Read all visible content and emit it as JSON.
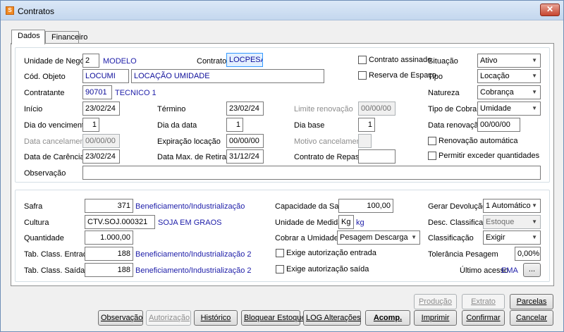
{
  "window": {
    "title": "Contratos"
  },
  "tabs": [
    {
      "label": "Dados"
    },
    {
      "label": "Financeiro"
    }
  ],
  "dados": {
    "unidade_negocio": {
      "label": "Unidade de Negócio",
      "value": "2",
      "desc": "MODELO"
    },
    "contrato": {
      "label": "Contrato",
      "value": "LOCPESAG"
    },
    "contrato_assinado": {
      "label": "Contrato assinado"
    },
    "situacao": {
      "label": "Situação",
      "value": "Ativo"
    },
    "cod_objeto": {
      "label": "Cód. Objeto",
      "value": "LOCUMI",
      "desc": "LOCAÇÃO UMIDADE"
    },
    "reserva_espaco": {
      "label": "Reserva de Espaço"
    },
    "tipo": {
      "label": "Tipo",
      "value": "Locação"
    },
    "contratante": {
      "label": "Contratante",
      "value": "90701",
      "desc": "TECNICO 1"
    },
    "natureza": {
      "label": "Natureza",
      "value": "Cobrança"
    },
    "inicio": {
      "label": "Início",
      "value": "23/02/24"
    },
    "termino": {
      "label": "Término",
      "value": "23/02/24"
    },
    "limite_renovacao": {
      "label": "Limite renovação",
      "value": "00/00/00"
    },
    "tipo_cobranca": {
      "label": "Tipo de Cobrança",
      "value": "Umidade"
    },
    "dia_vencimento": {
      "label": "Dia do vencimento",
      "value": "1"
    },
    "dia_data": {
      "label": "Dia da data",
      "value": "1"
    },
    "dia_base": {
      "label": "Dia base",
      "value": "1"
    },
    "data_renovacao": {
      "label": "Data renovação",
      "value": "00/00/00"
    },
    "data_cancelamento": {
      "label": "Data cancelamento",
      "value": "00/00/00"
    },
    "expiracao_locacao": {
      "label": "Expiração locação",
      "value": "00/00/00"
    },
    "motivo_cancelamento": {
      "label": "Motivo cancelamento",
      "value": ""
    },
    "renovacao_automatica": {
      "label": "Renovação automática"
    },
    "data_carencia": {
      "label": "Data de Carência",
      "value": "23/02/24"
    },
    "data_max_retirada": {
      "label": "Data Max. de Retirada",
      "value": "31/12/24"
    },
    "contrato_repasse": {
      "label": "Contrato de Repasse",
      "value": ""
    },
    "permitir_exceder": {
      "label": "Permitir exceder quantidades"
    },
    "observacao": {
      "label": "Observação",
      "value": ""
    }
  },
  "produto": {
    "safra": {
      "label": "Safra",
      "value": "371",
      "desc": "Beneficiamento/Industrialização"
    },
    "capacidade_saca": {
      "label": "Capacidade da Saca",
      "value": "100,00"
    },
    "gerar_devolucao": {
      "label": "Gerar Devolução",
      "value": "1 Automático"
    },
    "cultura": {
      "label": "Cultura",
      "value": "CTV.SOJ.000321",
      "desc": "SOJA EM GRAOS"
    },
    "unidade_medida": {
      "label": "Unidade de Medida",
      "value": "Kg",
      "desc": "kg"
    },
    "desc_classificacao": {
      "label": "Desc. Classificação",
      "value": "Estoque"
    },
    "quantidade": {
      "label": "Quantidade",
      "value": "1.000,00"
    },
    "cobrar_unidade": {
      "label": "Cobrar a Umidade",
      "value": "Pesagem Descarga"
    },
    "classificacao": {
      "label": "Classificação",
      "value": "Exigir"
    },
    "tab_class_entrada": {
      "label": "Tab. Class. Entrada",
      "value": "188",
      "desc": "Beneficiamento/Industrialização 2"
    },
    "exige_aut_entrada": {
      "label": "Exige autorização entrada"
    },
    "tolerancia_pesagem": {
      "label": "Tolerância Pesagem",
      "value": "0,00%"
    },
    "tab_class_saida": {
      "label": "Tab. Class. Saída",
      "value": "188",
      "desc": "Beneficiamento/Industrialização 2"
    },
    "exige_aut_saida": {
      "label": "Exige autorização saída"
    },
    "ultimo_acesso": {
      "label": "Último acesso",
      "value": "EMA",
      "button": "..."
    }
  },
  "buttons": {
    "producao": "Produção",
    "extrato": "Extrato",
    "parcelas": "Parcelas",
    "observacao": "Observação",
    "autorizacao": "Autorização",
    "historico": "Histórico",
    "bloquear_estoque": "Bloquear Estoque",
    "log_alteracoes": "LOG Alterações",
    "acomp": "Acomp.",
    "imprimir": "Imprimir",
    "confirmar": "Confirmar",
    "cancelar": "Cancelar"
  }
}
